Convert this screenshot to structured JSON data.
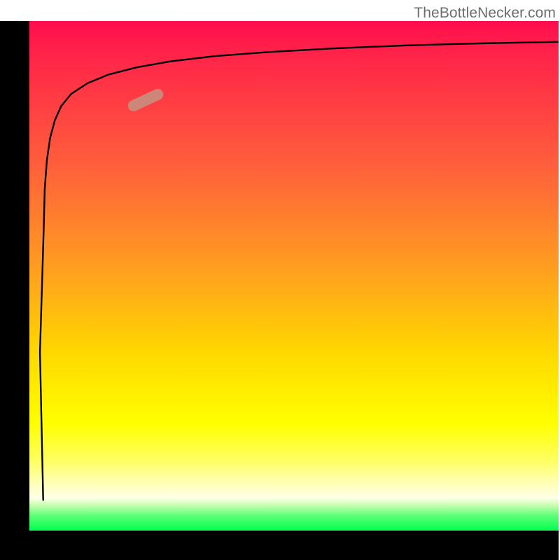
{
  "watermark": "TheBottleNecker.com",
  "colors": {
    "gradient_top": "#ff0d4d",
    "gradient_mid": "#ffd800",
    "gradient_bottom": "#00ff50",
    "axis": "#000000",
    "curve": "#000000",
    "marker": "#cc8779",
    "watermark": "#6d6d6d"
  },
  "chart_data": {
    "type": "line",
    "title": "",
    "xlabel": "",
    "ylabel": "",
    "xlim": [
      0,
      100
    ],
    "ylim": [
      0,
      100
    ],
    "axes_labeled": false,
    "background": "vertical gradient red→orange→yellow→green (top→bottom)",
    "series": [
      {
        "name": "curve",
        "description": "Starts at bottom-left, shoots up near-vertically along the left edge, then asymptotically levels off toward the top-right.",
        "x": [
          2.6,
          2.0,
          2.7,
          2.9,
          3.3,
          3.9,
          4.8,
          6.0,
          7.9,
          11.0,
          15.0,
          20.3,
          26.8,
          35.0,
          45.0,
          57.0,
          71.0,
          85.0,
          100.0
        ],
        "y": [
          6.0,
          35.0,
          59.0,
          67.0,
          72.6,
          77.0,
          80.5,
          83.3,
          85.7,
          87.8,
          89.5,
          90.9,
          92.1,
          93.1,
          93.9,
          94.6,
          95.2,
          95.6,
          95.9
        ]
      }
    ],
    "annotations": [
      {
        "name": "marker-pill",
        "shape": "rounded-rect",
        "color": "#cc8779",
        "approx_x": 22.0,
        "approx_y": 84.5,
        "rotation_deg": -25
      }
    ]
  }
}
